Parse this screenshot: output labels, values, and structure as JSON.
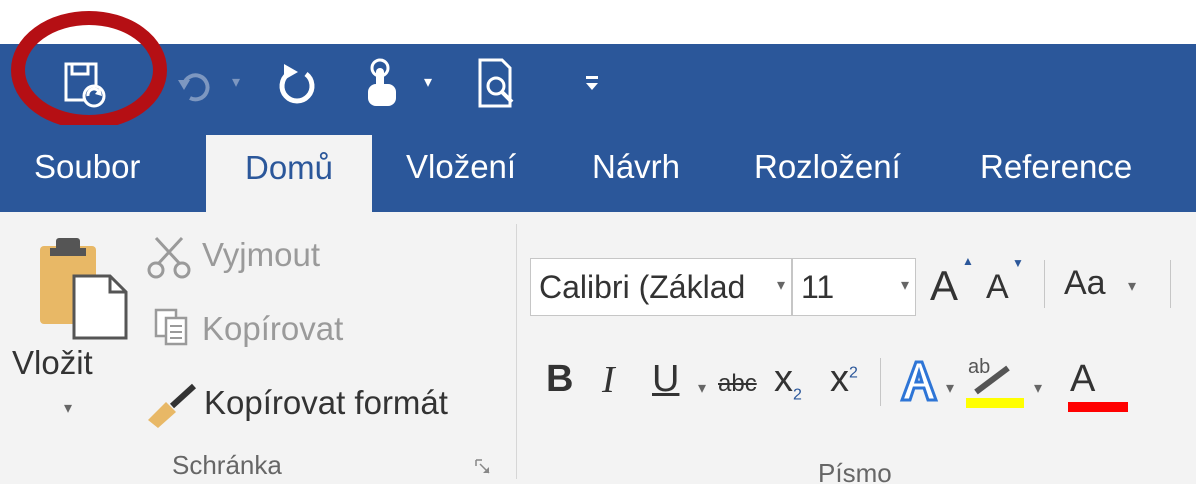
{
  "quick_access": {
    "icons": [
      "save-refresh-icon",
      "undo-icon",
      "redo-icon",
      "touch-mode-icon",
      "print-preview-icon",
      "customize-qat-icon"
    ],
    "highlight_color": "#b50f14"
  },
  "tabs": [
    {
      "label": "Soubor"
    },
    {
      "label": "Domů"
    },
    {
      "label": "Vložení"
    },
    {
      "label": "Návrh"
    },
    {
      "label": "Rozložení"
    },
    {
      "label": "Reference"
    }
  ],
  "clipboard": {
    "paste_label": "Vložit",
    "cut_label": "Vyjmout",
    "copy_label": "Kopírovat",
    "format_painter_label": "Kopírovat formát",
    "group_label": "Schránka"
  },
  "font": {
    "font_name": "Calibri (Základ",
    "font_size": "11",
    "grow_label": "A",
    "shrink_label": "A",
    "change_case_label": "Aa",
    "bold_label": "B",
    "italic_label": "I",
    "underline_label": "U",
    "strike_label": "abc",
    "subscript_label": "x",
    "subscript_sub": "2",
    "superscript_label": "x",
    "superscript_sup": "2",
    "highlight_sample": "ab",
    "font_color_label": "A",
    "group_label": "Písmo"
  },
  "colors": {
    "brand_blue": "#2b579a",
    "ribbon_bg": "#f3f3f3",
    "highlight_yellow": "#ffff00",
    "font_red": "#ff0000"
  }
}
